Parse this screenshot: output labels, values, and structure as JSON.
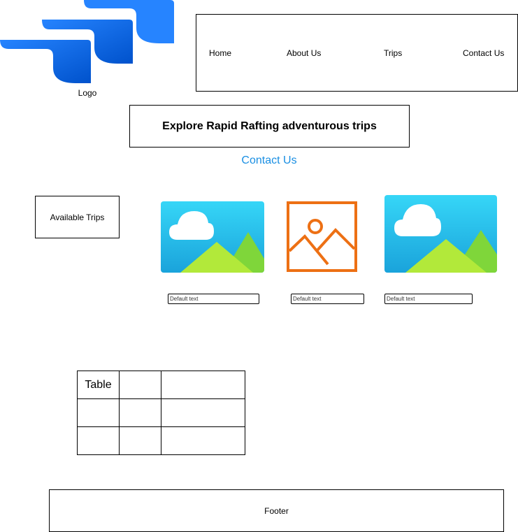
{
  "logo": {
    "label": "Logo",
    "icon": "stacked-ribbons-logo-icon",
    "color": "#2684ff"
  },
  "nav": {
    "items": [
      {
        "label": "Home"
      },
      {
        "label": "About Us"
      },
      {
        "label": "Trips"
      },
      {
        "label": "Contact Us"
      }
    ]
  },
  "hero": {
    "title": "Explore Rapid Rafting adventurous trips"
  },
  "contact_link": {
    "label": "Contact Us",
    "color": "#1a8fe3"
  },
  "available_trips": {
    "label": "Available Trips"
  },
  "trips": [
    {
      "icon": "landscape-image-icon",
      "input_placeholder": "Default text"
    },
    {
      "icon": "image-outline-icon",
      "input_placeholder": "Default text"
    },
    {
      "icon": "landscape-image-icon",
      "input_placeholder": "Default text"
    }
  ],
  "table": {
    "header_cell": "Table",
    "rows": 3,
    "cols": 3
  },
  "footer": {
    "label": "Footer"
  }
}
